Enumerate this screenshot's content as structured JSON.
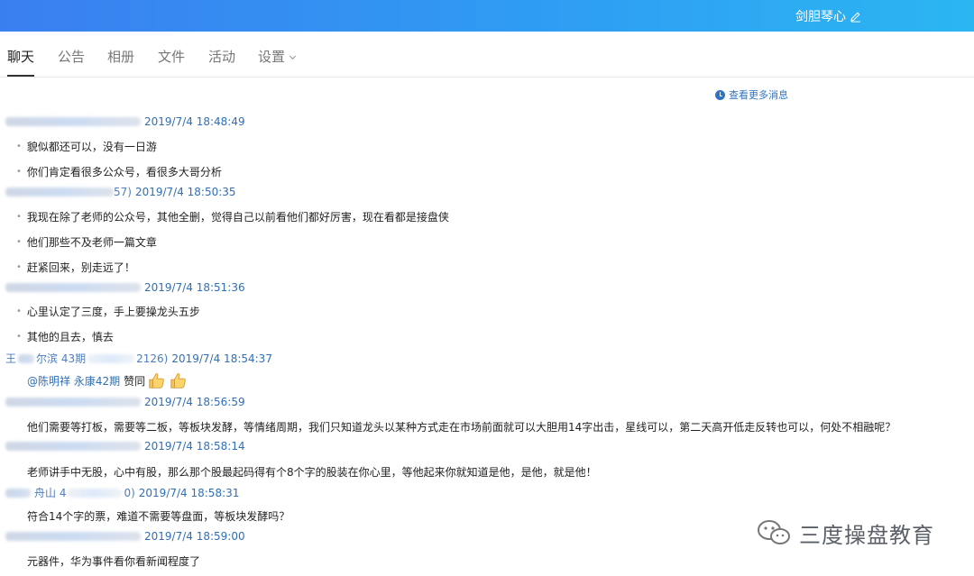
{
  "topbar": {
    "group_name": "剑胆琴心"
  },
  "tabs": [
    {
      "label": "聊天",
      "active": true
    },
    {
      "label": "公告"
    },
    {
      "label": "相册"
    },
    {
      "label": "文件"
    },
    {
      "label": "活动"
    },
    {
      "label": "设置"
    }
  ],
  "chat": {
    "more_label": "查看更多消息",
    "messages": [
      {
        "fragment_pre": "",
        "fragment_post": "",
        "time": "2019/7/4 18:48:49",
        "lines": [
          "貌似都还可以，没有一日游",
          "你们肯定看很多公众号，看很多大哥分析"
        ]
      },
      {
        "fragment_pre": "",
        "fragment_post": "57)",
        "time": "2019/7/4 18:50:35",
        "lines": [
          "我现在除了老师的公众号，其他全删，觉得自己以前看他们都好厉害，现在看都是接盘侠",
          "他们那些不及老师一篇文章",
          "赶紧回来，别走远了！"
        ]
      },
      {
        "fragment_pre": "",
        "fragment_post": "",
        "time": "2019/7/4 18:51:36",
        "lines": [
          "心里认定了三度，手上要操龙头五步",
          "其他的且去，慎去"
        ]
      },
      {
        "fragment_pre": "王",
        "fragment_mid": "尔滨 43期",
        "fragment_post": "2126)",
        "time": "2019/7/4 18:54:37",
        "mention": "@陈明祥 永康42期",
        "reply": "赞同"
      },
      {
        "fragment_pre": "",
        "fragment_post": "",
        "time": "2019/7/4 18:56:59",
        "lines": [
          "他们需要等打板，需要等二板，等板块发酵，等情绪周期，我们只知道龙头以某种方式走在市场前面就可以大胆用14字出击，星线可以，第二天高开低走反转也可以，何处不相融呢？"
        ]
      },
      {
        "fragment_pre": "",
        "fragment_post": "",
        "time": "2019/7/4 18:58:14",
        "lines": [
          "老师讲手中无股，心中有股，那么那个股最起码得有个8个字的股装在你心里，等他起来你就知道是他，是他，就是他！"
        ]
      },
      {
        "fragment_pre": "",
        "fragment_mid": "舟山 4",
        "fragment_post": "0)",
        "time": "2019/7/4 18:58:31",
        "lines": [
          "符合14个字的票，难道不需要等盘面，等板块发酵吗？"
        ]
      },
      {
        "fragment_pre": "",
        "fragment_post": "",
        "time": "2019/7/4 18:59:00",
        "lines": [
          "元器件，华为事件看你看新闻程度了"
        ]
      }
    ]
  },
  "watermark": {
    "text": "三度操盘教育"
  }
}
